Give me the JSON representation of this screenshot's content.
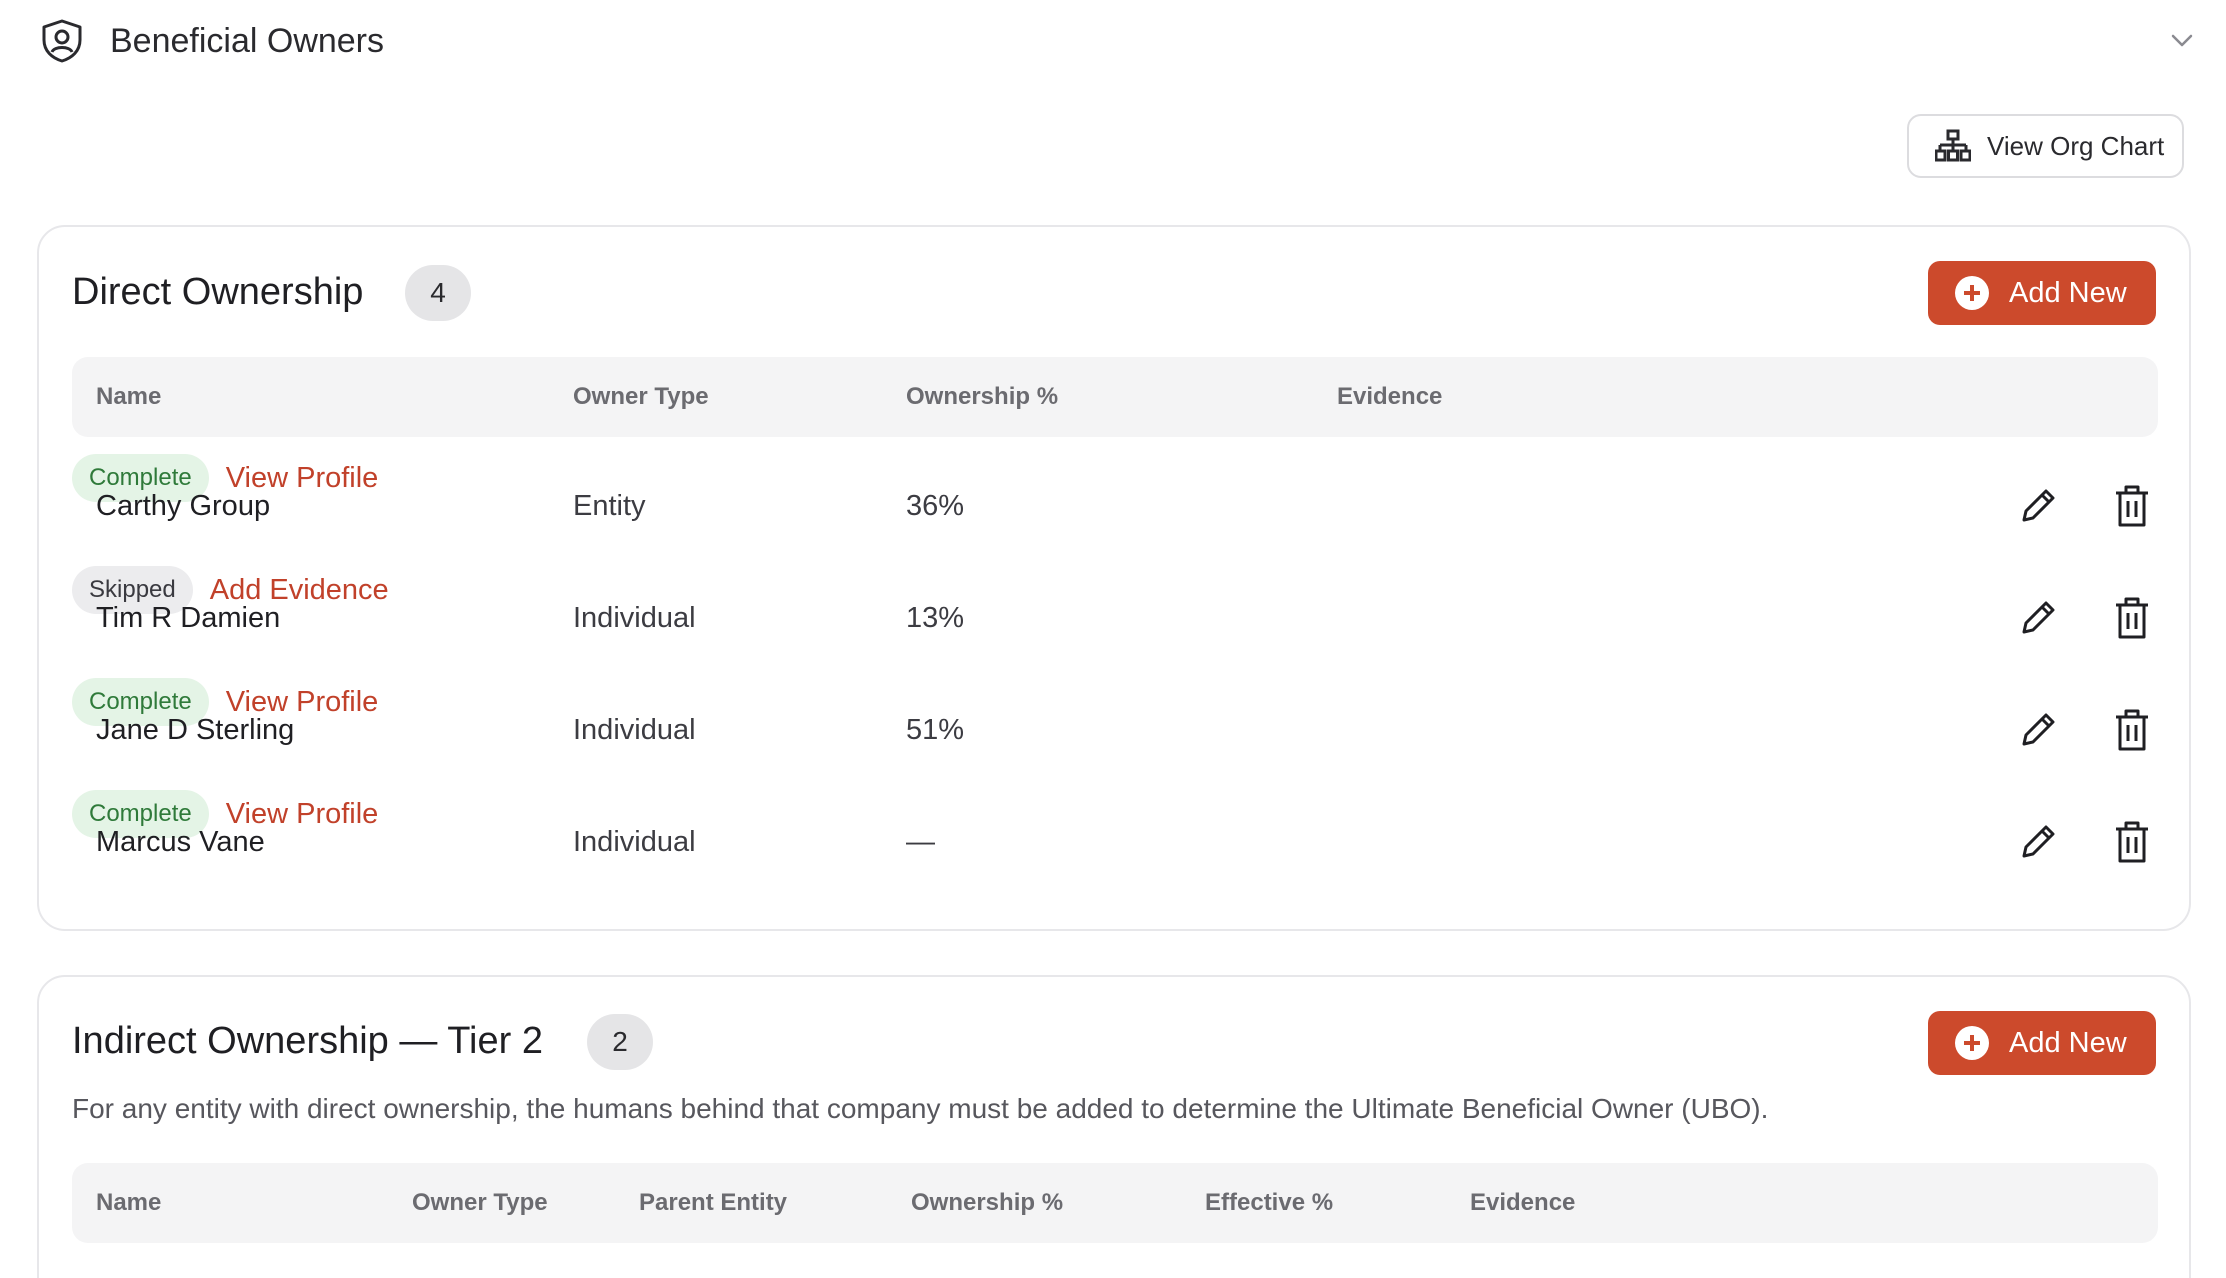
{
  "header": {
    "title": "Beneficial Owners"
  },
  "toolbar": {
    "org_chart_label": "View Org Chart"
  },
  "direct": {
    "title": "Direct Ownership",
    "count": "4",
    "add_label": "Add New",
    "columns": [
      "Name",
      "Owner Type",
      "Ownership %",
      "Evidence"
    ],
    "rows": [
      {
        "name": "Carthy Group",
        "type": "Entity",
        "pct": "36%",
        "status": "Complete",
        "status_kind": "complete",
        "link": "View Profile"
      },
      {
        "name": "Tim R Damien",
        "type": "Individual",
        "pct": "13%",
        "status": "Skipped",
        "status_kind": "skipped",
        "link": "Add Evidence"
      },
      {
        "name": "Jane D Sterling",
        "type": "Individual",
        "pct": "51%",
        "status": "Complete",
        "status_kind": "complete",
        "link": "View Profile"
      },
      {
        "name": "Marcus Vane",
        "type": "Individual",
        "pct": "—",
        "status": "Complete",
        "status_kind": "complete",
        "link": "View Profile"
      }
    ]
  },
  "indirect": {
    "title": "Indirect Ownership — Tier 2",
    "count": "2",
    "add_label": "Add New",
    "description": "For any entity with direct ownership, the humans behind that company must be added to determine the Ultimate Beneficial Owner (UBO).",
    "columns": [
      "Name",
      "Owner Type",
      "Parent Entity",
      "Ownership %",
      "Effective %",
      "Evidence"
    ]
  },
  "colors": {
    "accent": "#cc4a2c",
    "link": "#c1412a",
    "complete_bg": "#e4f4e6",
    "complete_fg": "#2f7a3a",
    "skipped_bg": "#ececee"
  },
  "icons": {
    "header": "shield-user-icon",
    "collapse": "chevron-down-icon",
    "org_chart": "org-chart-icon",
    "add": "plus-circle-icon",
    "edit": "pencil-icon",
    "delete": "trash-icon"
  }
}
